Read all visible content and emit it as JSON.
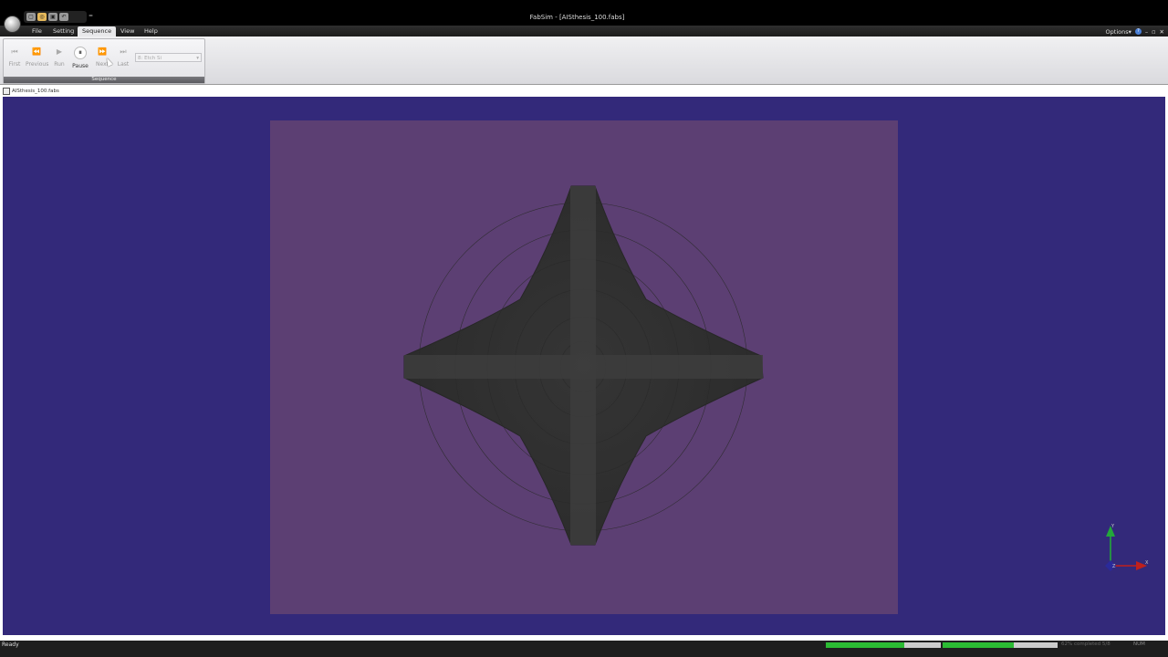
{
  "window": {
    "title": "FabSim - [AISthesis_100.fabs]"
  },
  "quick_access": {
    "buttons": [
      "new-icon",
      "open-icon",
      "save-icon",
      "undo-icon"
    ],
    "dropdown": "="
  },
  "menu": {
    "tabs": [
      {
        "label": "File",
        "active": false
      },
      {
        "label": "Setting",
        "active": false
      },
      {
        "label": "Sequence",
        "active": true
      },
      {
        "label": "View",
        "active": false
      },
      {
        "label": "Help",
        "active": false
      }
    ],
    "options_label": "Options",
    "options_arrow": "▾",
    "help_glyph": "?",
    "minimize_glyph": "–",
    "restore_glyph": "▫",
    "close_glyph": "✕"
  },
  "ribbon": {
    "group_label": "Sequence",
    "buttons": [
      {
        "label": "First",
        "glyph": "⏮",
        "enabled": false
      },
      {
        "label": "Previous",
        "glyph": "⏪",
        "enabled": false
      },
      {
        "label": "Run",
        "glyph": "▶",
        "enabled": false
      },
      {
        "label": "Pause",
        "glyph": "⏸",
        "enabled": true
      },
      {
        "label": "Next",
        "glyph": "⏩",
        "enabled": false
      },
      {
        "label": "Last",
        "glyph": "⏭",
        "enabled": false
      }
    ],
    "step_select": {
      "value": "8: Etch Si",
      "arrow": "▾"
    }
  },
  "document": {
    "tab_label": "AISthesis_100.fabs"
  },
  "viewport": {
    "background_color": "#33297a",
    "plane_color": "#5c3f73",
    "shape_color": "#3a3a3a",
    "axes": {
      "x": "X",
      "y": "Y",
      "z": "Z",
      "x_color": "#c0201c",
      "y_color": "#23a83a",
      "z_color": "#2a2a9a"
    }
  },
  "status": {
    "text": "Ready",
    "progress1": 0.68,
    "progress2": 0.62,
    "progress_label": "62% completed 5/8",
    "num": "NUM"
  }
}
